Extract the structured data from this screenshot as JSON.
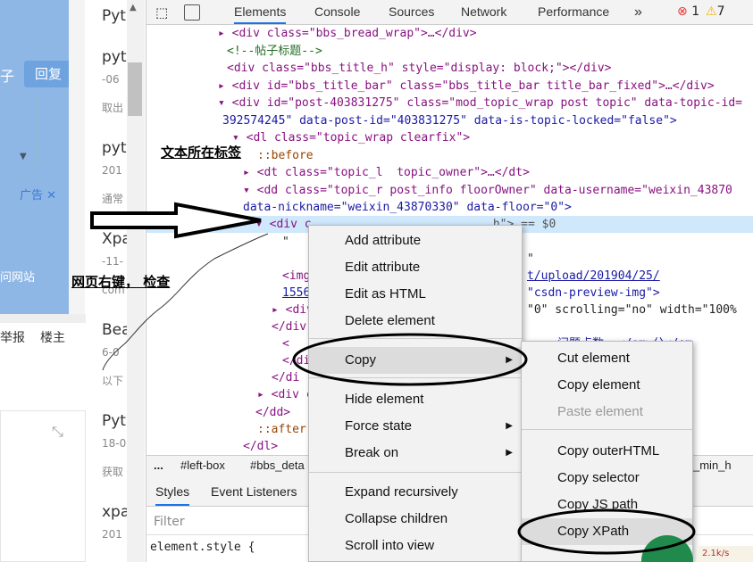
{
  "webpage": {
    "reply": "回复",
    "zi": "子",
    "ad": "广告",
    "visit": "问网站",
    "report": "举报",
    "floor_owner": "楼主",
    "items": [
      {
        "title": "Pyt",
        "sub": ""
      },
      {
        "title": "pyt",
        "sub": "-06"
      },
      {
        "title": "",
        "sub": "取出"
      },
      {
        "title": "pyt",
        "sub": "201"
      },
      {
        "title": "",
        "sub": "通常"
      },
      {
        "title": "Xpa",
        "sub": "-11-"
      },
      {
        "title": "",
        "sub": "com"
      },
      {
        "title": "Bea",
        "sub": "6-0"
      },
      {
        "title": "",
        "sub": "以下"
      },
      {
        "title": "Pyt",
        "sub": "18-0"
      },
      {
        "title": "",
        "sub": "获取"
      },
      {
        "title": "xpa",
        "sub": "201"
      }
    ]
  },
  "devtools": {
    "tabs": [
      "Elements",
      "Console",
      "Sources",
      "Network",
      "Performance"
    ],
    "errors": "1",
    "warnings": "7",
    "more": "»",
    "crumbs": [
      "...",
      "#left-box",
      "#bbs_deta",
      "_min_h"
    ],
    "styles_tabs": [
      "Styles",
      "Event Listeners"
    ],
    "filter_placeholder": "Filter",
    "element_style": "element.style {",
    "lines": [
      "<div class=\"bbs_bread_wrap\">…</div>",
      "<!--帖子标题-->",
      "<div class=\"bbs_title_h\" style=\"display: block;\"></div>",
      "<div id=\"bbs_title_bar\" class=\"bbs_title_bar title_bar_fixed\">…</div>",
      "<div id=\"post-403831275\" class=\"mod_topic_wrap post topic\" data-topic-id=",
      "392574245\" data-post-id=\"403831275\" data-is-topic-locked=\"false\">",
      "<dl class=\"topic_wrap clearfix\">",
      "::before",
      "<dt class=\"topic_l  topic_owner\">…</dt>",
      "<dd class=\"topic_r post_info floorOwner\" data-username=\"weixin_43870",
      "data-nickname=\"weixin_43870330\" data-floor=\"0\">",
      "<div c",
      "\"",
      "<img",
      "1556",
      "<div",
      "</div",
      "<",
      "</di",
      "</di",
      "<div c",
      "</dd>",
      "::after",
      "</dl>"
    ],
    "sel_suffix": "_h\"> == $0",
    "right_frag": {
      "l1": "\"",
      "l2": "t/upload/201904/25/",
      "l3": "\"csdn-preview-img\">",
      "l4": "\"0\" scrolling=\"no\" width=\"100%",
      "l5": "问题点数 …</em>分</em"
    }
  },
  "menu": {
    "items": [
      "Add attribute",
      "Edit attribute",
      "Edit as HTML",
      "Delete element",
      "Copy",
      "Hide element",
      "Force state",
      "Break on",
      "Expand recursively",
      "Collapse children",
      "Scroll into view"
    ]
  },
  "submenu": {
    "items": [
      "Cut element",
      "Copy element",
      "Paste element",
      "Copy outerHTML",
      "Copy selector",
      "Copy JS path",
      "Copy XPath"
    ]
  },
  "annotations": {
    "tag_location": "文本所在标签",
    "right_click": "网页右键， 检查"
  },
  "speed": "2.1k/s"
}
